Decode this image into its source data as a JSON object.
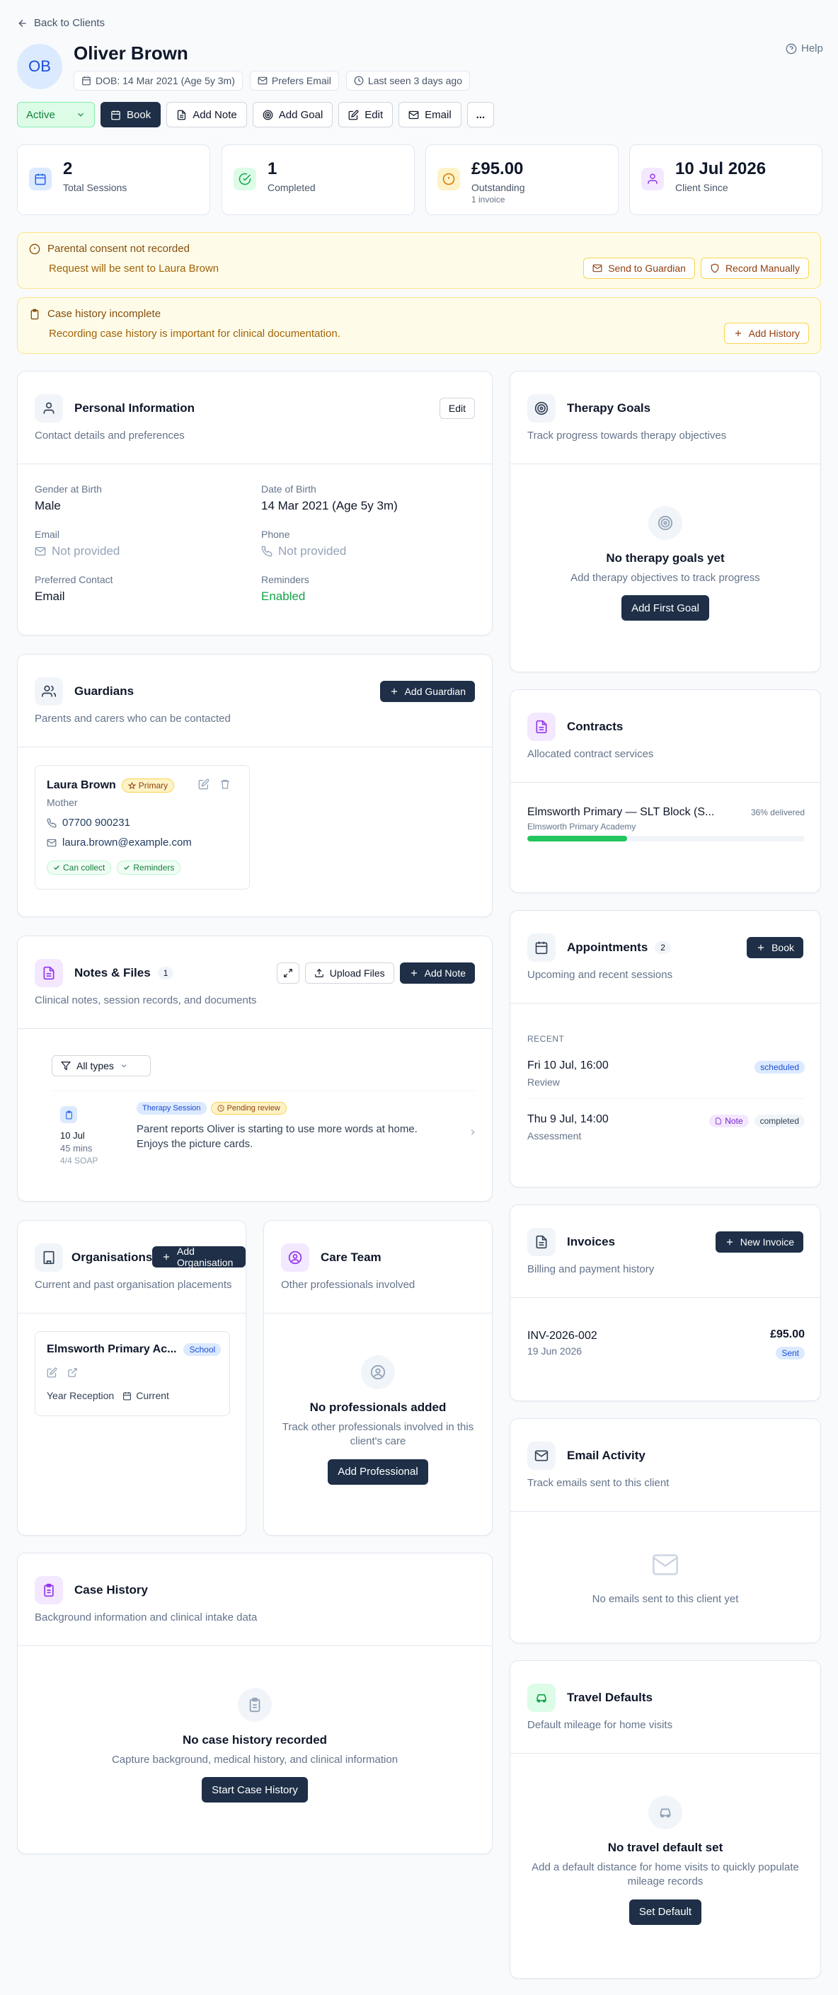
{
  "nav": {
    "back": "Back to Clients",
    "help": "Help"
  },
  "client": {
    "initials": "OB",
    "name": "Oliver Brown",
    "dob": "DOB: 14 Mar 2021 (Age 5y 3m)",
    "contact_pref": "Prefers Email",
    "last_seen": "Last seen 3 days ago"
  },
  "toolbar": {
    "status": "Active",
    "book": "Book",
    "add_note": "Add Note",
    "add_goal": "Add Goal",
    "edit": "Edit",
    "email": "Email",
    "more": "..."
  },
  "stats": [
    {
      "value": "2",
      "label": "Total Sessions",
      "sub": ""
    },
    {
      "value": "1",
      "label": "Completed",
      "sub": ""
    },
    {
      "value": "£95.00",
      "label": "Outstanding",
      "sub": "1 invoice"
    },
    {
      "value": "10 Jul 2026",
      "label": "Client Since",
      "sub": ""
    }
  ],
  "alerts": {
    "consent": {
      "title": "Parental consent not recorded",
      "text": "Request will be sent to Laura Brown",
      "btn1": "Send to Guardian",
      "btn2": "Record Manually"
    },
    "history": {
      "title": "Case history incomplete",
      "text": "Recording case history is important for clinical documentation.",
      "btn": "Add History"
    }
  },
  "personal": {
    "title": "Personal Information",
    "subtitle": "Contact details and preferences",
    "edit": "Edit",
    "fields": [
      {
        "label": "Gender at Birth",
        "value": "Male"
      },
      {
        "label": "Date of Birth",
        "value": "14 Mar 2021 (Age 5y 3m)"
      },
      {
        "label": "Email",
        "value": "Not provided"
      },
      {
        "label": "Phone",
        "value": "Not provided"
      },
      {
        "label": "Preferred Contact",
        "value": "Email"
      },
      {
        "label": "Reminders",
        "value": "Enabled"
      }
    ]
  },
  "guardians": {
    "title": "Guardians",
    "subtitle": "Parents and carers who can be contacted",
    "add": "Add Guardian",
    "item": {
      "name": "Laura Brown",
      "badge": "Primary",
      "relation": "Mother",
      "phone": "07700 900231",
      "email": "laura.brown@example.com",
      "tag1": "Can collect",
      "tag2": "Reminders"
    }
  },
  "notes": {
    "title": "Notes & Files",
    "count": "1",
    "subtitle": "Clinical notes, session records, and documents",
    "upload": "Upload Files",
    "add": "Add Note",
    "filter": "All types",
    "item": {
      "date": "10 Jul",
      "duration": "45 mins",
      "soap": "4/4 SOAP",
      "tag1": "Therapy Session",
      "tag2": "Pending review",
      "text": "Parent reports Oliver is starting to use more words at home. Enjoys the picture cards."
    }
  },
  "orgs": {
    "title": "Organisations",
    "subtitle": "Current and past organisation placements",
    "add": "Add Organisation",
    "item": {
      "name": "Elmsworth Primary Ac...",
      "badge": "School",
      "year": "Year Reception",
      "status": "Current"
    }
  },
  "care": {
    "title": "Care Team",
    "subtitle": "Other professionals involved",
    "empty_title": "No professionals added",
    "empty_text": "Track other professionals involved in this client's care",
    "btn": "Add Professional"
  },
  "casehist": {
    "title": "Case History",
    "subtitle": "Background information and clinical intake data",
    "empty_title": "No case history recorded",
    "empty_text": "Capture background, medical history, and clinical information",
    "btn": "Start Case History"
  },
  "goals": {
    "title": "Therapy Goals",
    "subtitle": "Track progress towards therapy objectives",
    "empty_title": "No therapy goals yet",
    "empty_text": "Add therapy objectives to track progress",
    "btn": "Add First Goal"
  },
  "contracts": {
    "title": "Contracts",
    "subtitle": "Allocated contract services",
    "item": {
      "name": "Elmsworth Primary — SLT Block (S...",
      "org": "Elmsworth Primary Academy",
      "delivered": "36% delivered",
      "progress": 0.36
    }
  },
  "appts": {
    "title": "Appointments",
    "count": "2",
    "subtitle": "Upcoming and recent sessions",
    "book": "Book",
    "section": "RECENT",
    "items": [
      {
        "when": "Fri 10 Jul, 16:00",
        "type": "Review",
        "note": "",
        "status": "scheduled"
      },
      {
        "when": "Thu 9 Jul, 14:00",
        "type": "Assessment",
        "note": "Note",
        "status": "completed"
      }
    ]
  },
  "invoices": {
    "title": "Invoices",
    "subtitle": "Billing and payment history",
    "new": "New Invoice",
    "item": {
      "number": "INV-2026-002",
      "date": "19 Jun 2026",
      "amount": "£95.00",
      "status": "Sent"
    }
  },
  "emails": {
    "title": "Email Activity",
    "subtitle": "Track emails sent to this client",
    "empty": "No emails sent to this client yet"
  },
  "travel": {
    "title": "Travel Defaults",
    "subtitle": "Default mileage for home visits",
    "empty_title": "No travel default set",
    "empty_text": "Add a default distance for home visits to quickly populate mileage records",
    "btn": "Set Default"
  },
  "colors": {
    "primary": "#1e2f47",
    "active": "#15803d",
    "alert_bg": "#fefce8",
    "progress": "#22c55e"
  }
}
